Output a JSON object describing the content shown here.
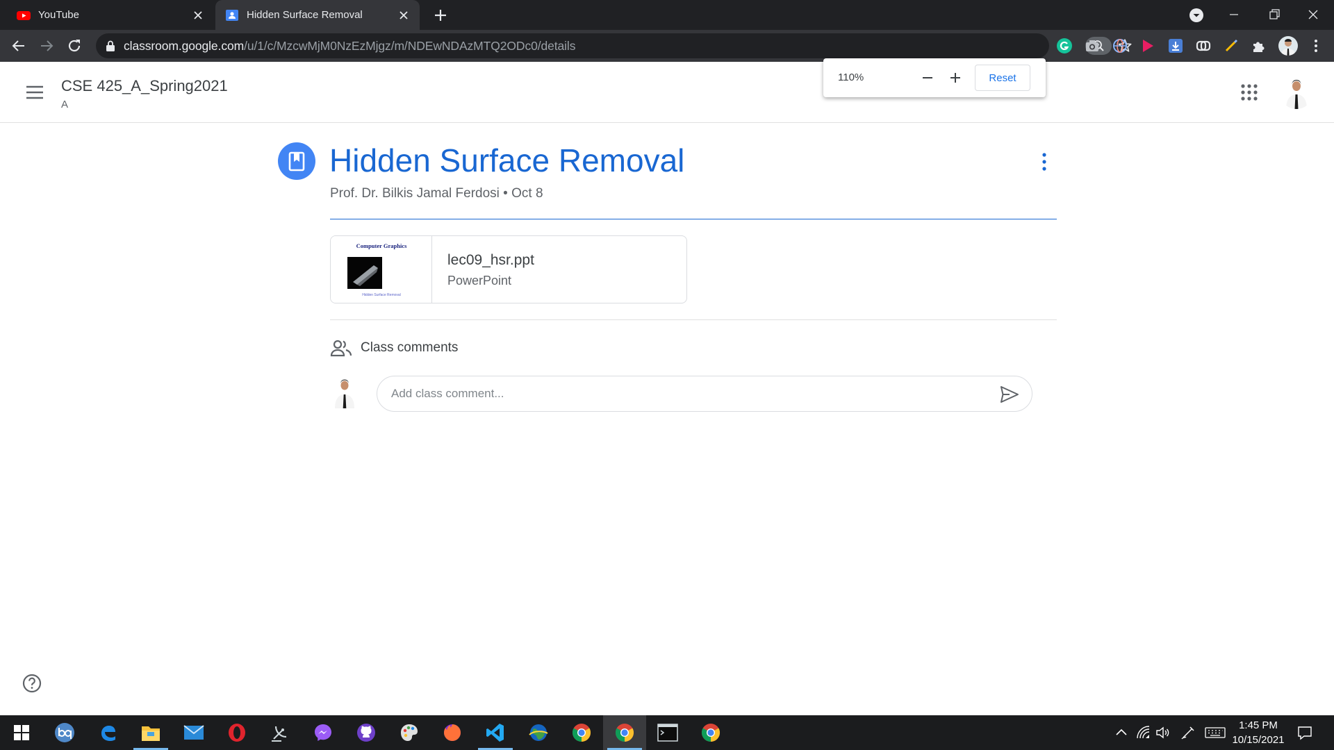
{
  "browser": {
    "tabs": [
      {
        "title": "YouTube",
        "favicon": "youtube-icon"
      },
      {
        "title": "Hidden Surface Removal",
        "favicon": "classroom-icon",
        "active": true
      }
    ],
    "url_host": "classroom.google.com",
    "url_path": "/u/1/c/MzcwMjM0NzEzMjgz/m/NDEwNDAzMTQ2ODc0/details",
    "extensions": [
      "grammarly-icon",
      "camera-icon",
      "globe-icon",
      "play-icon",
      "download-icon",
      "link-icon",
      "pen-icon",
      "puzzle-icon"
    ]
  },
  "zoom": {
    "level": "110%",
    "reset_label": "Reset"
  },
  "classroom": {
    "class_name": "CSE 425_A_Spring2021",
    "section": "A"
  },
  "material": {
    "title": "Hidden Surface Removal",
    "meta": "Prof. Dr. Bilkis Jamal Ferdosi • Oct 8",
    "attachment": {
      "name": "lec09_hsr.ppt",
      "type": "PowerPoint",
      "thumb_caption": "Computer Graphics",
      "thumb_footer": "Hidden Surface Removal"
    }
  },
  "comments": {
    "label": "Class comments",
    "placeholder": "Add class comment..."
  },
  "taskbar": {
    "apps": [
      "start-icon",
      "qbittorrent-icon",
      "edge-icon",
      "file-explorer-icon",
      "mail-icon",
      "opera-icon",
      "satellite-icon",
      "messenger-icon",
      "github-icon",
      "paint-icon",
      "firefox-icon",
      "vscode-icon",
      "earth-icon",
      "chrome-icon",
      "chrome-icon",
      "terminal-icon",
      "chrome-icon"
    ],
    "time": "1:45 PM",
    "date": "10/15/2021"
  },
  "colors": {
    "accent": "#1967d2",
    "material_icon": "#4285f4",
    "chrome_dark": "#202124",
    "chrome_toolbar": "#35363a"
  }
}
